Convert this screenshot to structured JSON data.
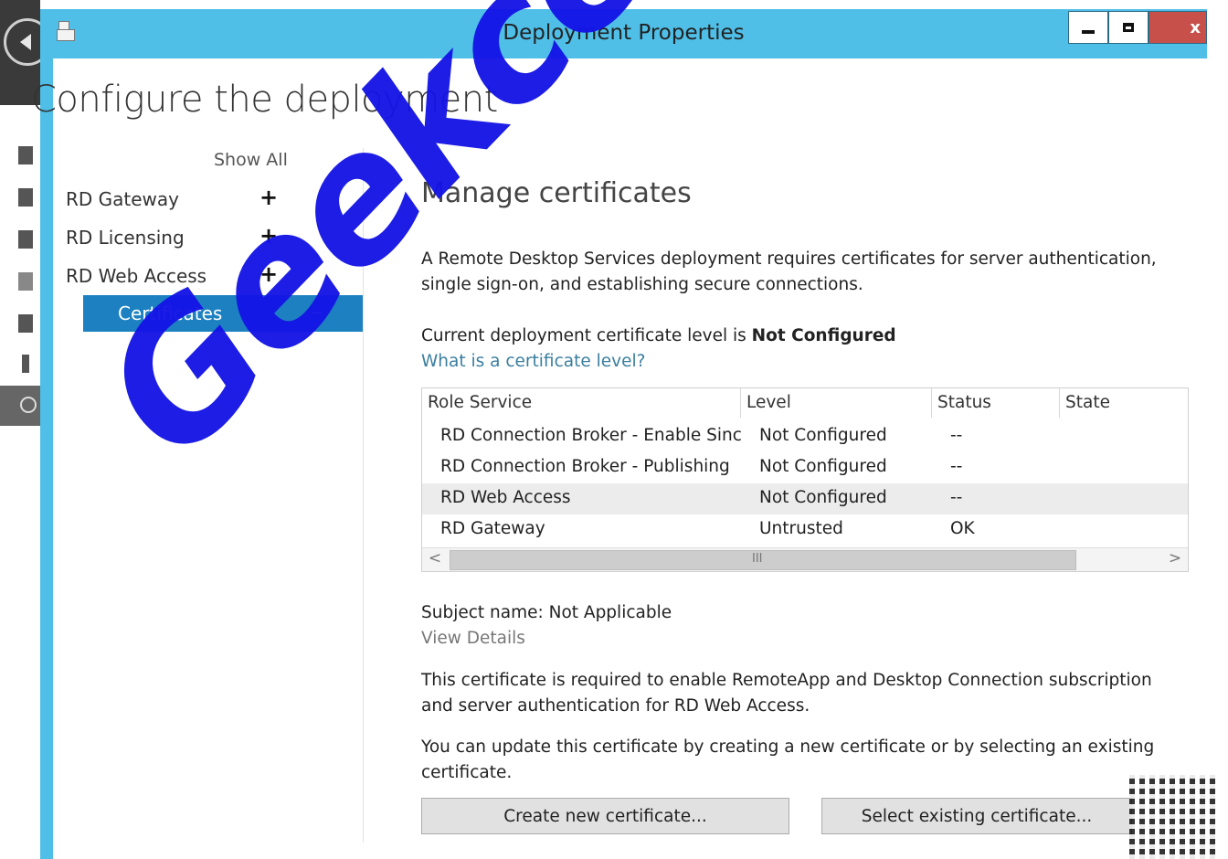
{
  "window": {
    "title": "Deployment Properties",
    "close_label": "x"
  },
  "page": {
    "heading": "Configure the deployment"
  },
  "nav": {
    "show_all": "Show All",
    "items": [
      {
        "label": "RD Gateway",
        "sign": "+"
      },
      {
        "label": "RD Licensing",
        "sign": "+"
      },
      {
        "label": "RD Web Access",
        "sign": "+"
      },
      {
        "label": "Certificates",
        "sign": "–",
        "selected": true
      }
    ]
  },
  "main": {
    "title": "Manage certificates",
    "intro": "A Remote Desktop Services deployment requires certificates for server authentication, single sign-on, and establishing secure connections.",
    "level_prefix": "Current deployment certificate level is ",
    "level_value": "Not Configured",
    "level_link": "What is a certificate level?",
    "table": {
      "headers": [
        "Role Service",
        "Level",
        "Status",
        "State"
      ],
      "rows": [
        {
          "role": "RD Connection Broker - Enable Sinc",
          "level": "Not Configured",
          "status": "--",
          "state": ""
        },
        {
          "role": "RD Connection Broker - Publishing",
          "level": "Not Configured",
          "status": "--",
          "state": ""
        },
        {
          "role": "RD Web Access",
          "level": "Not Configured",
          "status": "--",
          "state": ""
        },
        {
          "role": "RD Gateway",
          "level": "Untrusted",
          "status": "OK",
          "state": ""
        }
      ],
      "scroll_left": "<",
      "scroll_right": ">",
      "scroll_grip": "III"
    },
    "subject": "Subject name: Not Applicable",
    "view_details": "View Details",
    "required_text": "This certificate is required to enable RemoteApp and Desktop Connection subscription and server authentication for RD Web Access.",
    "update_text": "You can update this certificate by creating a new certificate or by selecting an existing certificate.",
    "create_button": "Create new certificate...",
    "select_button": "Select existing certificate..."
  },
  "watermark": {
    "text": "Geekcer"
  },
  "colors": {
    "titlebar": "#4fbfe8",
    "selected_nav": "#1c80c1",
    "watermark": "#1414e6",
    "link": "#3a7f9e"
  }
}
